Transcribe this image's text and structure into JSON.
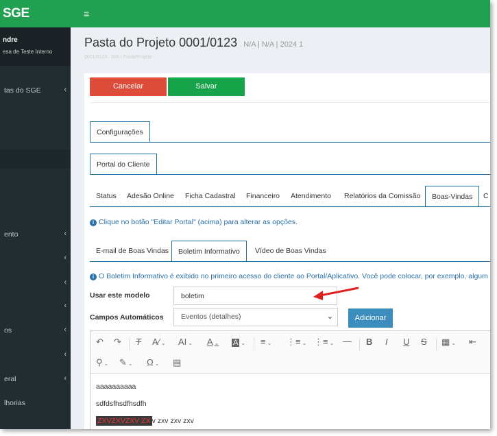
{
  "app": {
    "logo": "SGE",
    "menu_toggle": "≡"
  },
  "sidebar": {
    "user_name": "ndre",
    "user_org": "esa de Teste Interno",
    "items": [
      {
        "label": "tas do SGE",
        "chevron": "‹"
      },
      {
        "label": "",
        "chevron": ""
      },
      {
        "label": "ento",
        "chevron": "‹"
      },
      {
        "label": "",
        "chevron": "‹"
      },
      {
        "label": "",
        "chevron": "‹"
      },
      {
        "label": "",
        "chevron": "‹"
      },
      {
        "label": "os",
        "chevron": "‹"
      },
      {
        "label": "",
        "chevron": "‹"
      },
      {
        "label": "eral",
        "chevron": "‹"
      },
      {
        "label": "lhorias",
        "chevron": ""
      }
    ]
  },
  "page": {
    "title": "Pasta do Projeto 0001/0123",
    "title_meta": "N/A | N/A | 2024 1",
    "subtitle": "0001/0123 · N/A | Pasta/Projeto"
  },
  "actions": {
    "cancel": "Cancelar",
    "save": "Salvar"
  },
  "tabs_level1": [
    {
      "label": "Configurações",
      "active": true
    }
  ],
  "tabs_level2": [
    {
      "label": "Portal do Cliente",
      "active": true
    }
  ],
  "tabs_level3": [
    {
      "label": "Status",
      "active": false
    },
    {
      "label": "Adesão Online",
      "active": false
    },
    {
      "label": "Ficha Cadastral",
      "active": false
    },
    {
      "label": "Financeiro",
      "active": false
    },
    {
      "label": "Atendimento",
      "active": false
    },
    {
      "label": "Relatórios da Comissão",
      "active": false
    },
    {
      "label": "Boas-Vindas",
      "active": true
    },
    {
      "label": "C",
      "active": false
    }
  ],
  "info_portal": "Clique no botão \"Editar Portal\" (acima) para alterar as opções.",
  "tabs_level4": [
    {
      "label": "E-mail de Boas Vindas",
      "active": false
    },
    {
      "label": "Boletim Informativo",
      "active": true
    },
    {
      "label": "Vídeo de Boas Vindas",
      "active": false
    }
  ],
  "info_boletim": "O Boletim Informativo é exibido no primeiro acesso do cliente ao Portal/Aplicativo. Você pode colocar, por exemplo, algum",
  "form": {
    "model_label": "Usar este modelo",
    "model_value": "boletim",
    "fields_label": "Campos Automáticos",
    "fields_selected": "Eventos (detalhes)",
    "add_button": "Adicionar"
  },
  "editor": {
    "lines": [
      "aaaaaaaaaa",
      "sdfdsfhsdfhsdfh"
    ],
    "line3_highlight": "ZXVZXVZXV ZX",
    "line3_rest": "v zxv zxv zxv"
  },
  "colors": {
    "topbar": "#20a050",
    "sidebar": "#222d32",
    "cancel": "#dd4b39",
    "save": "#16a34a",
    "primary": "#3c8dbc",
    "tab_border": "#1e6fa8",
    "arrow": "#e02020"
  },
  "icons": [
    "menu-icon",
    "chevron-left-icon",
    "info-icon",
    "undo-icon",
    "redo-icon",
    "clear-format-icon",
    "font-size-icon",
    "font-family-icon",
    "font-color-icon",
    "highlight-icon",
    "align-icon",
    "bullet-list-icon",
    "numbered-list-icon",
    "horizontal-line-icon",
    "bold-icon",
    "italic-icon",
    "underline-icon",
    "strikethrough-icon",
    "table-icon",
    "find-replace-icon",
    "pen-icon",
    "special-char-icon",
    "source-icon"
  ]
}
